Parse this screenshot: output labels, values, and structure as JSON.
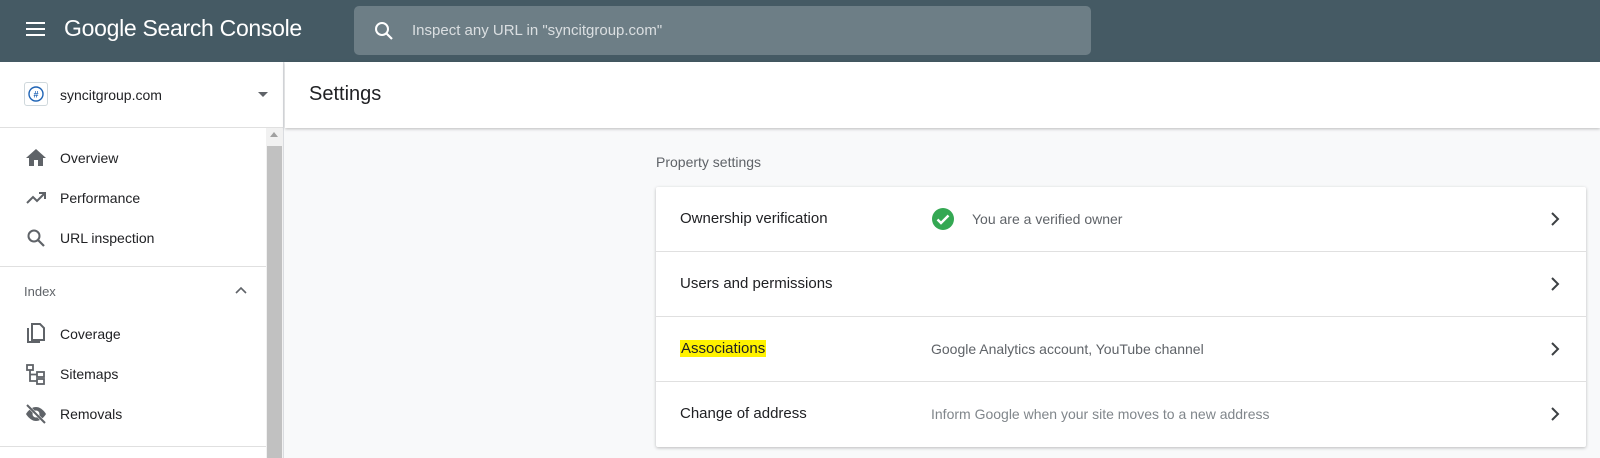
{
  "topbar": {
    "menu_icon": "menu-icon",
    "logo_google": "Google",
    "logo_product": "Search Console",
    "search_icon": "search-icon",
    "search_placeholder": "Inspect any URL in \"syncitgroup.com\""
  },
  "sidebar": {
    "property": {
      "name": "syncitgroup.com",
      "icon": "site-favicon",
      "caret_icon": "dropdown-caret-icon"
    },
    "items": [
      {
        "label": "Overview",
        "icon": "home-icon"
      },
      {
        "label": "Performance",
        "icon": "trending-up-icon"
      },
      {
        "label": "URL inspection",
        "icon": "search-icon"
      }
    ],
    "index_section": {
      "title": "Index",
      "collapse_icon": "chevron-up-icon",
      "items": [
        {
          "label": "Coverage",
          "icon": "copy-pages-icon"
        },
        {
          "label": "Sitemaps",
          "icon": "sitemap-icon"
        },
        {
          "label": "Removals",
          "icon": "visibility-off-icon"
        }
      ]
    }
  },
  "main": {
    "page_title": "Settings",
    "section_label": "Property settings",
    "rows": [
      {
        "label": "Ownership verification",
        "description": "You are a verified owner",
        "status_icon": "check-circle-icon",
        "status_color": "#34a853"
      },
      {
        "label": "Users and permissions",
        "description": ""
      },
      {
        "label": "Associations",
        "description": "Google Analytics account, YouTube channel",
        "highlighted": true,
        "highlight_color": "#fff200"
      },
      {
        "label": "Change of address",
        "description": "Inform Google when your site moves to a new address"
      }
    ],
    "chevron_icon": "chevron-right-icon"
  },
  "colors": {
    "topbar": "#455a64",
    "background": "#f8f9fa",
    "text_primary": "#202124",
    "text_secondary": "#5f6368"
  }
}
